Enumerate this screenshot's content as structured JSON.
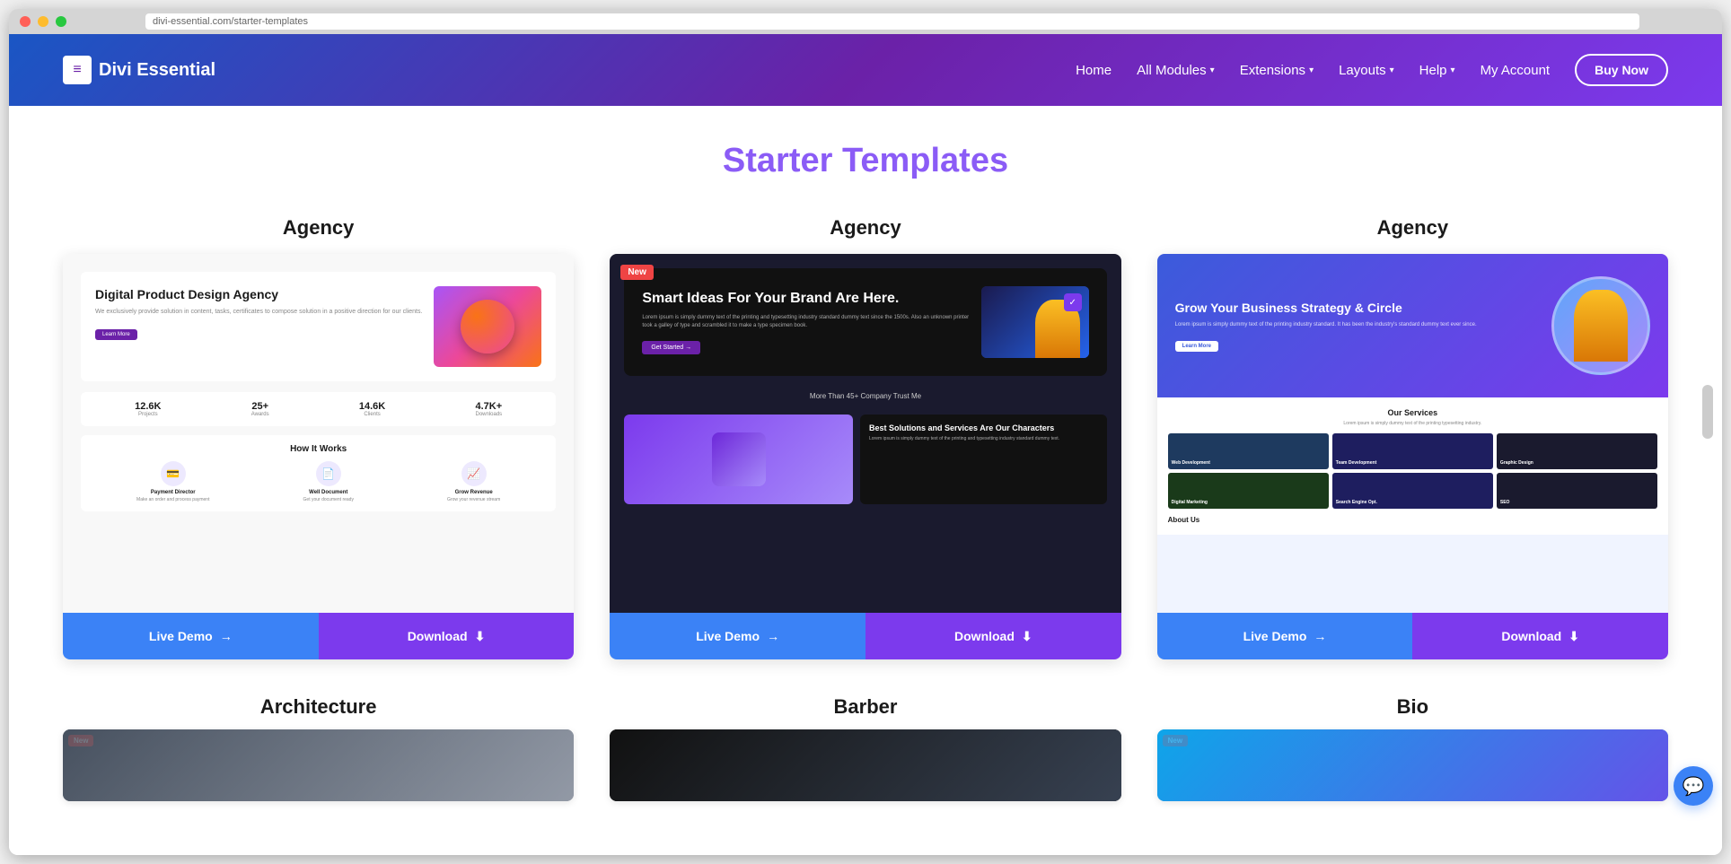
{
  "window": {
    "url": "divi-essential.com/starter-templates"
  },
  "nav": {
    "logo_text": "Divi Essential",
    "logo_icon": "≡",
    "links": [
      {
        "label": "Home",
        "has_dropdown": false
      },
      {
        "label": "All Modules",
        "has_dropdown": true
      },
      {
        "label": "Extensions",
        "has_dropdown": true
      },
      {
        "label": "Layouts",
        "has_dropdown": true
      },
      {
        "label": "Help",
        "has_dropdown": true
      },
      {
        "label": "My Account",
        "has_dropdown": false
      }
    ],
    "cta_label": "Buy Now"
  },
  "page": {
    "title": "Starter Templates"
  },
  "templates": [
    {
      "category": "Agency",
      "badge": null,
      "hero_title": "Digital Product Design Agency",
      "stats": [
        "12.6K",
        "25+",
        "14.6K",
        "4.7K+"
      ],
      "stats_labels": [
        "",
        "",
        "",
        ""
      ],
      "section_title": "How It Works",
      "items": [
        "Payment Director",
        "Well Document",
        "Grow Revenue"
      ],
      "demo_label": "Live Demo",
      "download_label": "Download"
    },
    {
      "category": "Agency",
      "badge": "New",
      "hero_title": "Smart Ideas For Your Brand Are Here.",
      "trust_text": "More Than 45+ Company Trust Me",
      "solutions_title": "Best Solutions and Services Are Our Characters",
      "demo_label": "Live Demo",
      "download_label": "Download"
    },
    {
      "category": "Agency",
      "badge": null,
      "hero_title": "Grow Your Business Strategy & Circle",
      "services_title": "Our Services",
      "service_tiles": [
        "Web Development",
        "Team Development",
        "Graphic Design",
        "Digital Marketing",
        "Search Engine Opt."
      ],
      "demo_label": "Live Demo",
      "download_label": "Download"
    }
  ],
  "bottom_categories": [
    {
      "label": "Architecture",
      "badge": "New"
    },
    {
      "label": "Barber",
      "badge": null
    },
    {
      "label": "Bio",
      "badge": "New"
    }
  ],
  "icons": {
    "arrow_right": "→",
    "download_icon": "⬇",
    "chat_icon": "💬",
    "chevron_down": "▾"
  }
}
